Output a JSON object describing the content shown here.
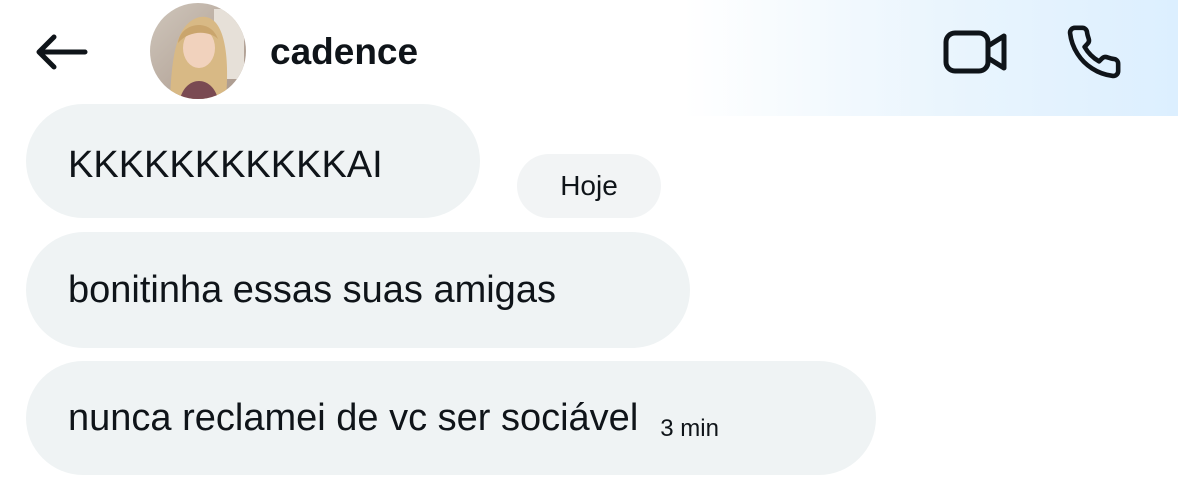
{
  "header": {
    "contact_name": "cadence",
    "back_icon": "arrow-left-icon",
    "video_icon": "video-camera-icon",
    "call_icon": "phone-icon"
  },
  "conversation": {
    "date_label": "Hoje",
    "messages": [
      {
        "text": "KKKKKKKKKKKAI",
        "time": ""
      },
      {
        "text": "bonitinha essas suas amigas",
        "time": ""
      },
      {
        "text": "nunca reclamei de vc ser sociável",
        "time": "3 min"
      }
    ]
  },
  "colors": {
    "bubble_bg": "#eff3f4",
    "text": "#0f1419",
    "header_gradient_end": "#dcefff"
  }
}
